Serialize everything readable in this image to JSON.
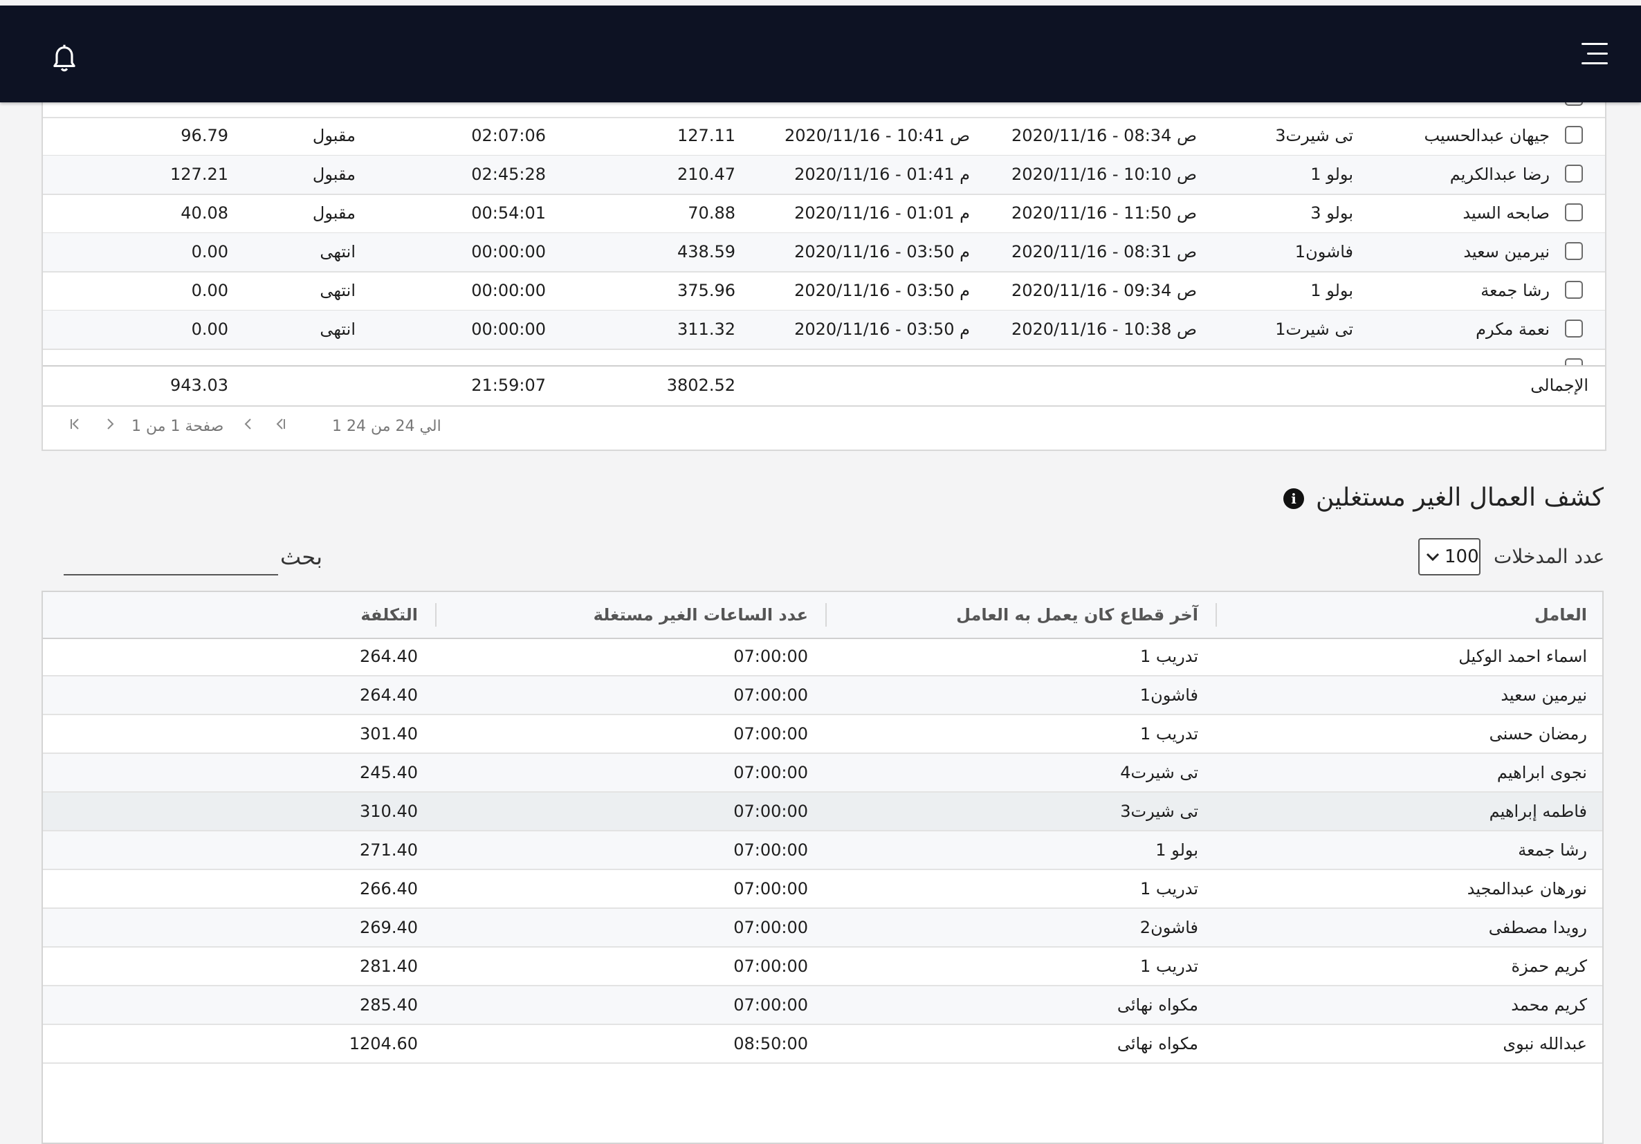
{
  "header": {
    "menu_icon": "hamburger-icon",
    "bell_icon": "bell-icon"
  },
  "top_table": {
    "rows": [
      {
        "name": "جيهان عبدالحسيب",
        "sector": "تى شيرت3",
        "start": "2020/11/16 - 08:34 ص",
        "end": "2020/11/16 - 10:41 ص",
        "cost": "127.11",
        "time": "02:07:06",
        "status": "مقبول",
        "value": "96.79"
      },
      {
        "name": "رضا عبدالكريم",
        "sector": "بولو 1",
        "start": "2020/11/16 - 10:10 ص",
        "end": "2020/11/16 - 01:41 م",
        "cost": "210.47",
        "time": "02:45:28",
        "status": "مقبول",
        "value": "127.21"
      },
      {
        "name": "صابحه السيد",
        "sector": "بولو 3",
        "start": "2020/11/16 - 11:50 ص",
        "end": "2020/11/16 - 01:01 م",
        "cost": "70.88",
        "time": "00:54:01",
        "status": "مقبول",
        "value": "40.08"
      },
      {
        "name": "نيرمين سعيد",
        "sector": "فاشون1",
        "start": "2020/11/16 - 08:31 ص",
        "end": "2020/11/16 - 03:50 م",
        "cost": "438.59",
        "time": "00:00:00",
        "status": "انتهى",
        "value": "0.00"
      },
      {
        "name": "رشا جمعة",
        "sector": "بولو 1",
        "start": "2020/11/16 - 09:34 ص",
        "end": "2020/11/16 - 03:50 م",
        "cost": "375.96",
        "time": "00:00:00",
        "status": "انتهى",
        "value": "0.00"
      },
      {
        "name": "نعمة مكرم",
        "sector": "تى شيرت1",
        "start": "2020/11/16 - 10:38 ص",
        "end": "2020/11/16 - 03:50 م",
        "cost": "311.32",
        "time": "00:00:00",
        "status": "انتهى",
        "value": "0.00"
      }
    ],
    "totals": {
      "label": "الإجمالى",
      "cost": "3802.52",
      "time": "21:59:07",
      "value": "943.03"
    },
    "pager": {
      "range": "1 الي 24 من 24",
      "page": "صفحة 1 من 1"
    }
  },
  "idle": {
    "title": "كشف العمال الغير مستغلين",
    "entries_label": "عدد المدخلات",
    "entries_value": "100",
    "search_label": "بحث",
    "columns": [
      "العامل",
      "آخر قطاع كان يعمل به العامل",
      "عدد الساعات الغير مستغلة",
      "التكلفة"
    ],
    "rows": [
      {
        "worker": "اسماء احمد الوكيل",
        "sector": "تدريب 1",
        "hours": "07:00:00",
        "cost": "264.40"
      },
      {
        "worker": "نيرمين سعيد",
        "sector": "فاشون1",
        "hours": "07:00:00",
        "cost": "264.40"
      },
      {
        "worker": "رمضان حسنى",
        "sector": "تدريب 1",
        "hours": "07:00:00",
        "cost": "301.40"
      },
      {
        "worker": "نجوى ابراهيم",
        "sector": "تى شيرت4",
        "hours": "07:00:00",
        "cost": "245.40"
      },
      {
        "worker": "فاطمه إبراهيم",
        "sector": "تى شيرت3",
        "hours": "07:00:00",
        "cost": "310.40"
      },
      {
        "worker": "رشا جمعة",
        "sector": "بولو 1",
        "hours": "07:00:00",
        "cost": "271.40"
      },
      {
        "worker": "نورهان عبدالمجيد",
        "sector": "تدريب 1",
        "hours": "07:00:00",
        "cost": "266.40"
      },
      {
        "worker": "رويدا مصطفى",
        "sector": "فاشون2",
        "hours": "07:00:00",
        "cost": "269.40"
      },
      {
        "worker": "كريم حمزة",
        "sector": "تدريب 1",
        "hours": "07:00:00",
        "cost": "281.40"
      },
      {
        "worker": "كريم محمد",
        "sector": "مكواه نهائى",
        "hours": "07:00:00",
        "cost": "285.40"
      },
      {
        "worker": "عبدالله نبوى",
        "sector": "مكواه نهائى",
        "hours": "08:50:00",
        "cost": "1204.60"
      }
    ]
  }
}
